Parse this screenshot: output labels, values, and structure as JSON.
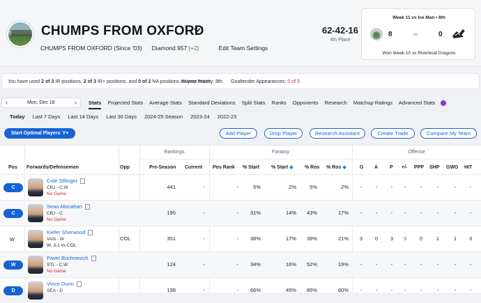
{
  "header": {
    "team_name": "CHUMPS FROM OXFORD",
    "team_since": "CHUMPS FROM OXFORD (Since '03)",
    "rank_label": "Diamond 957",
    "rank_delta": "(+2)",
    "edit_link": "Edit Team Settings",
    "record": "62-42-16",
    "place": "4th Place"
  },
  "matchup": {
    "title": "Week 11 vs Ice Man • 8th",
    "my_score": "8",
    "vs": "vs",
    "opp_score": "0",
    "footer": "Won Week 10 vs Riverboat Dragons"
  },
  "notice": {
    "ir_prefix": "You have used ",
    "ir_used": "2 of 3",
    "ir_mid1": " IR positions, ",
    "irp_used": "2 of 3",
    "ir_mid2": " IR+ positions, and ",
    "na_used": "0 of 2",
    "ir_suffix": " NA positions on your roster.",
    "waiver": "Waiver Priority: 8th",
    "goalie_label": "Goaltender Appearances: ",
    "goalie_value": "0 of 3"
  },
  "date_picker": {
    "date": "Mon, Dec 16"
  },
  "tabs": [
    "Stats",
    "Projected Stats",
    "Average Stats",
    "Standard Deviations",
    "Split Stats",
    "Ranks",
    "Opponents",
    "Research",
    "Matchup Ratings",
    "Advanced Stats"
  ],
  "ranges": [
    "Today",
    "Last 7 Days",
    "Last 14 Days",
    "Last 30 Days",
    "2024-25 Season",
    "2023-24",
    "2022-23"
  ],
  "actions": {
    "optimal": "Start Optimal Players",
    "add": "Add Player",
    "drop": "Drop Player",
    "research": "Research Assistant",
    "trade": "Create Trade",
    "compare": "Compare My Team"
  },
  "table": {
    "groups": {
      "rankings": "Rankings",
      "fantasy": "Fantasy",
      "offense": "Offense"
    },
    "columns": {
      "pos": "Pos",
      "player": "Forwards/Defensemen",
      "opp": "Opp",
      "preseason": "Pre-Season",
      "current": "Current",
      "posrank": "Pos Rank",
      "pstart": "% Start",
      "pstart2": "% Start",
      "pros": "% Ros",
      "pros2": "% Ros",
      "g": "G",
      "a": "A",
      "p": "P",
      "pm": "+/-",
      "ppp": "PPP",
      "shp": "SHP",
      "gwg": "GWG",
      "hit": "HIT"
    },
    "rows": [
      {
        "pos": "C",
        "pill": true,
        "name": "Cole Sillinger",
        "team": "CBJ - C,W",
        "game": "No Game",
        "game_red": true,
        "opp": "",
        "preseason": "441",
        "current": "-",
        "posrank": "-",
        "pstart": "5%",
        "pstart2": "2%",
        "pros": "5%",
        "pros2": "2%",
        "g": "-",
        "a": "-",
        "p": "-",
        "pm": "-",
        "ppp": "-",
        "shp": "-",
        "gwg": "-",
        "hit": "-"
      },
      {
        "pos": "C",
        "pill": true,
        "name": "Sean Monahan",
        "team": "CBJ - C",
        "game": "No Game",
        "game_red": true,
        "opp": "",
        "preseason": "195",
        "current": "-",
        "posrank": "-",
        "pstart": "31%",
        "pstart2": "14%",
        "pros": "43%",
        "pros2": "17%",
        "g": "-",
        "a": "-",
        "p": "-",
        "pm": "-",
        "ppp": "-",
        "shp": "-",
        "gwg": "-",
        "hit": "-"
      },
      {
        "pos": "W",
        "pill": false,
        "name": "Kiefer Sherwood",
        "team": "VAN - W",
        "game": "W, 3-1 vs COL",
        "game_red": false,
        "opp": "COL",
        "preseason": "351",
        "current": "-",
        "posrank": "-",
        "pstart": "38%",
        "pstart2": "17%",
        "pros": "39%",
        "pros2": "21%",
        "g": "3",
        "a": "0",
        "p": "3",
        "pm": "3",
        "ppp": "0",
        "shp": "1",
        "gwg": "1",
        "hit": "3"
      },
      {
        "pos": "W",
        "pill": true,
        "name": "Pavel Buchnevich",
        "team": "STL - C,W",
        "game": "No Game",
        "game_red": true,
        "opp": "",
        "preseason": "124",
        "current": "-",
        "posrank": "-",
        "pstart": "34%",
        "pstart2": "16%",
        "pros": "52%",
        "pros2": "19%",
        "g": "-",
        "a": "-",
        "p": "-",
        "pm": "-",
        "ppp": "-",
        "shp": "-",
        "gwg": "-",
        "hit": "-"
      },
      {
        "pos": "D",
        "pill": true,
        "name": "Vince Dunn",
        "team": "SEA - D",
        "game": "",
        "game_red": false,
        "opp": "",
        "preseason": "198",
        "current": "-",
        "posrank": "-",
        "pstart": "66%",
        "pstart2": "49%",
        "pros": "85%",
        "pros2": "60%",
        "g": "-",
        "a": "-",
        "p": "-",
        "pm": "-",
        "ppp": "-",
        "shp": "-",
        "gwg": "-",
        "hit": "-"
      }
    ]
  },
  "colors": {
    "accent": "#1663d6",
    "red": "#d0202e",
    "green": "#1d8a3a"
  }
}
